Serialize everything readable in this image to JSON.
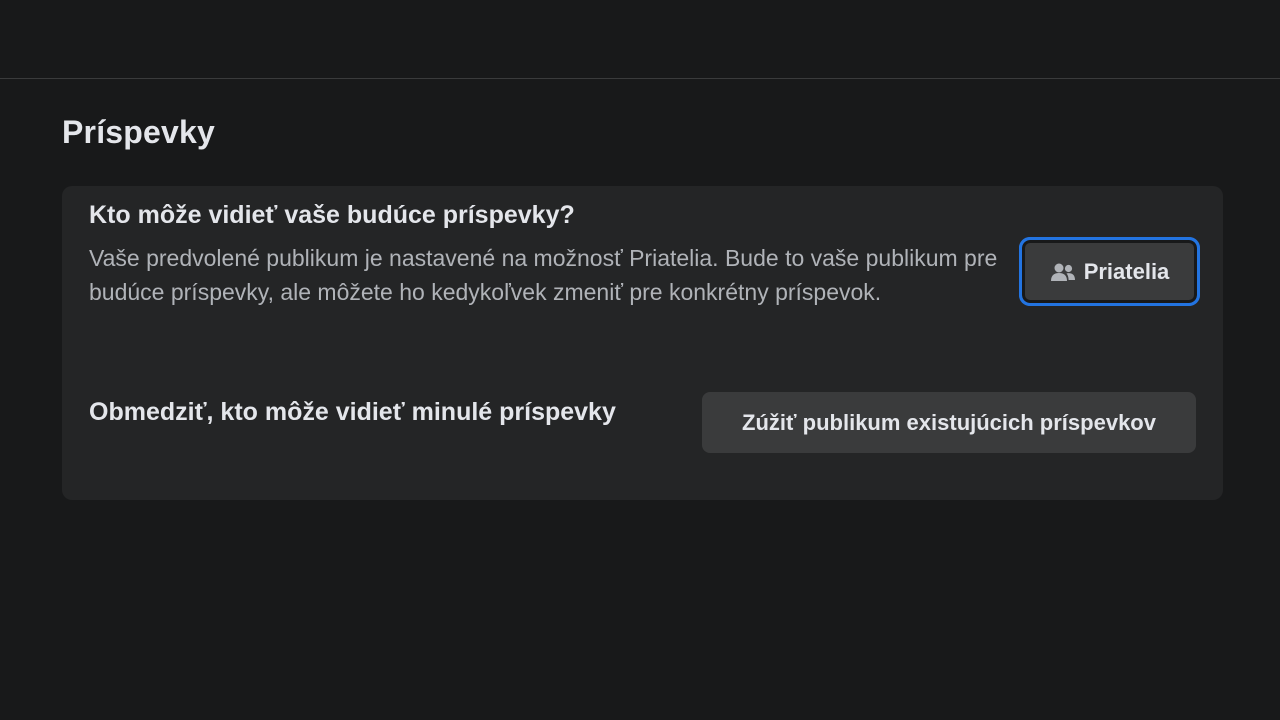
{
  "section": {
    "title": "Príspevky"
  },
  "future_posts": {
    "title": "Kto môže vidieť vaše budúce príspevky?",
    "description": "Vaše predvolené publikum je nastavené na možnosť Priatelia. Bude to vaše publikum pre budúce príspevky, ale môžete ho kedykoľvek zmeniť pre konkrétny príspevok.",
    "button_label": "Priatelia",
    "button_icon": "friends-icon"
  },
  "past_posts": {
    "title": "Obmedziť, kto môže vidieť minulé príspevky",
    "button_label": "Zúžiť publikum existujúcich príspevkov"
  },
  "colors": {
    "background": "#18191a",
    "card": "#242526",
    "button": "#3a3b3c",
    "focus_ring": "#2374e1",
    "text_primary": "#e4e6eb",
    "text_secondary": "#b0b3b8"
  }
}
